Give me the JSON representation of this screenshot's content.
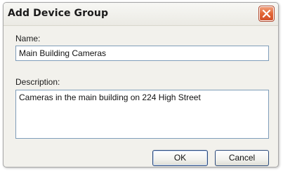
{
  "window": {
    "title": "Add Device Group"
  },
  "form": {
    "name_label": "Name:",
    "name_value": "Main Building Cameras",
    "description_label": "Description:",
    "description_value": "Cameras in the main building on 224 High Street"
  },
  "buttons": {
    "ok_label": "OK",
    "cancel_label": "Cancel"
  },
  "icons": {
    "close": "close-icon"
  },
  "colors": {
    "close_button": "#e26535",
    "field_border": "#7f9db9",
    "dialog_background": "#f2f1ec"
  }
}
